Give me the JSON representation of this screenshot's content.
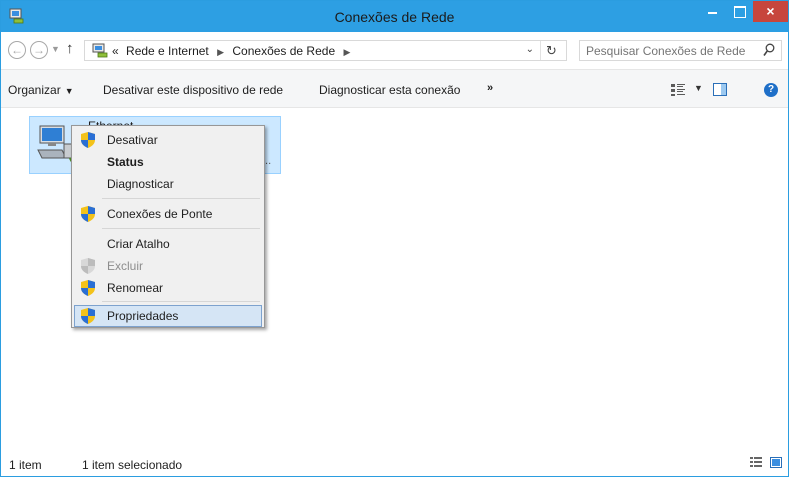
{
  "window": {
    "title": "Conexões de Rede",
    "close_glyph": "×"
  },
  "address": {
    "overflow_glyph": "«",
    "crumbs": [
      "Rede e Internet",
      "Conexões de Rede"
    ],
    "search_placeholder": "Pesquisar Conexões de Rede"
  },
  "commands": {
    "organize": "Organizar",
    "disable_device": "Desativar este dispositivo de rede",
    "diagnose": "Diagnosticar esta conexão",
    "more": "»"
  },
  "item": {
    "name": "Ethernet",
    "sub": "..."
  },
  "context_menu": {
    "items": [
      {
        "label": "Desativar",
        "shield": true
      },
      {
        "label": "Status",
        "bold": true
      },
      {
        "label": "Diagnosticar"
      },
      {
        "label": "Conexões de Ponte",
        "shield": true
      },
      {
        "label": "Criar Atalho"
      },
      {
        "label": "Excluir",
        "shield": true,
        "disabled": true
      },
      {
        "label": "Renomear",
        "shield": true
      },
      {
        "label": "Propriedades",
        "shield": true,
        "highlighted": true
      }
    ]
  },
  "status": {
    "count": "1 item",
    "selected": "1 item selecionado"
  },
  "colors": {
    "titlebar": "#2d9fe3",
    "close": "#c7463d",
    "selection": "#cce8ff",
    "menu_highlight": "#d5e5f5"
  },
  "icons": [
    "network-connections-icon",
    "back-icon",
    "forward-icon",
    "up-arrow-icon",
    "refresh-icon",
    "search-icon",
    "view-options-icon",
    "preview-pane-icon",
    "help-icon",
    "ethernet-adapter-icon",
    "uac-shield-icon"
  ]
}
